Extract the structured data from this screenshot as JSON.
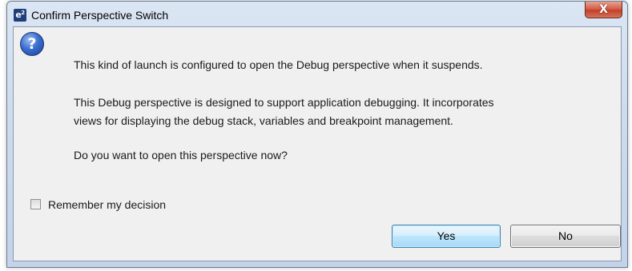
{
  "window": {
    "title": "Confirm Perspective Switch",
    "app_icon": "eclipse-e2-icon",
    "close_glyph": "X"
  },
  "dialog": {
    "icon": "question-icon",
    "icon_glyph": "?",
    "message_lines": [
      "This kind of launch is configured to open the Debug perspective when it suspends.",
      "This Debug perspective is designed to support application debugging.  It incorporates",
      "views for displaying the debug stack, variables and breakpoint management.",
      "Do you want to open this perspective now?"
    ],
    "remember_label": "Remember my decision",
    "remember_checked": false
  },
  "buttons": {
    "yes_label": "Yes",
    "no_label": "No"
  },
  "colors": {
    "default_button_border": "#3c7fb1",
    "close_button": "#c4402a",
    "question_icon": "#3a6fcf"
  }
}
